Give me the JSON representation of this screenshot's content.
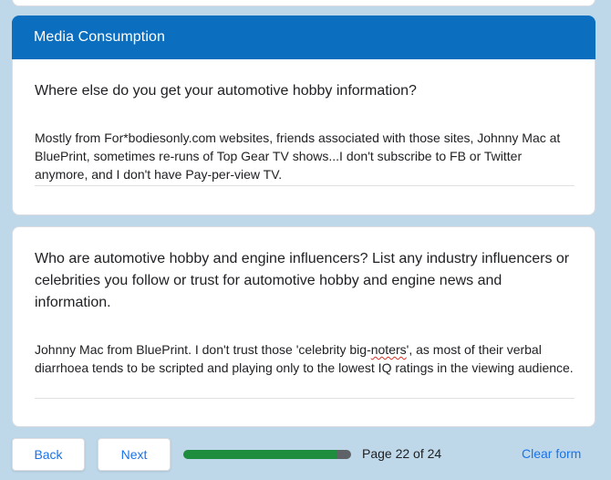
{
  "section": {
    "title": "Media Consumption"
  },
  "questions": [
    {
      "question": "Where else do you get your automotive hobby information?",
      "answer": "Mostly from For*bodiesonly.com websites, friends associated with those sites, Johnny Mac at BluePrint, sometimes re-runs of Top Gear TV shows...I don't subscribe to FB or Twitter anymore, and I don't have Pay-per-view TV."
    },
    {
      "question": "Who are automotive hobby and engine influencers? List any industry influencers or celebrities you follow or trust for automotive hobby and engine news and information.",
      "answer_part1": "Johnny Mac from BluePrint.   I don't trust those 'celebrity big-",
      "answer_misspelled": "noters",
      "answer_part2": "', as most of their verbal diarrhoea tends to be scripted and playing only to the lowest IQ ratings in the viewing audience."
    }
  ],
  "nav": {
    "back_label": "Back",
    "next_label": "Next",
    "page_label": "Page 22 of 24",
    "progress": 0.917,
    "clear_label": "Clear form"
  },
  "colors": {
    "header": "#0b6ebe",
    "progress_fill": "#1e8e3e",
    "progress_track": "#5f6368",
    "link": "#1a73e8",
    "background": "#bed8ea"
  }
}
